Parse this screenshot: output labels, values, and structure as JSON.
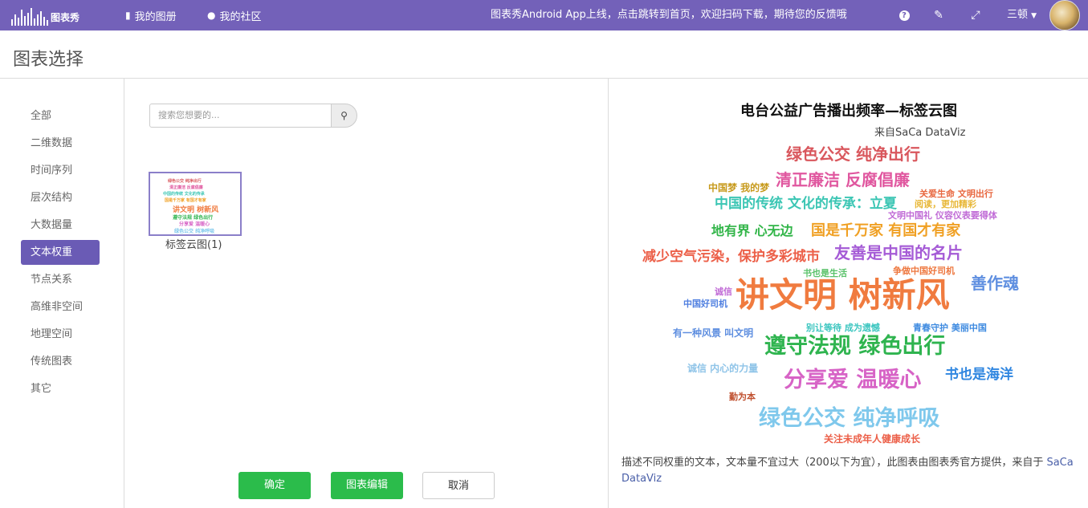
{
  "topbar": {
    "logo_text": "图表秀",
    "nav": [
      {
        "label": "我的图册",
        "icon": "book-icon"
      },
      {
        "label": "我的社区",
        "icon": "globe-icon"
      }
    ],
    "announcement": "图表秀Android App上线，点击跳转到首页，欢迎扫码下载，期待您的反馈哦",
    "help_glyph": "?",
    "user_name": "三顿",
    "background_color": "#7361b9"
  },
  "page": {
    "title": "图表选择"
  },
  "sidebar": {
    "active_index": 5,
    "items": [
      {
        "label": "全部"
      },
      {
        "label": "二维数据"
      },
      {
        "label": "时间序列"
      },
      {
        "label": "层次结构"
      },
      {
        "label": "大数据量"
      },
      {
        "label": "文本权重"
      },
      {
        "label": "节点关系"
      },
      {
        "label": "高维非空间"
      },
      {
        "label": "地理空间"
      },
      {
        "label": "传统图表"
      },
      {
        "label": "其它"
      }
    ]
  },
  "search": {
    "placeholder": "搜索您想要的..."
  },
  "gallery": {
    "items": [
      {
        "label": "标签云图(1)",
        "selected": true
      }
    ]
  },
  "buttons": {
    "confirm": "确定",
    "edit": "图表编辑",
    "cancel": "取消"
  },
  "preview": {
    "title": "电台公益广告播出频率—标签云图",
    "subtitle": "来自SaCa DataViz",
    "description": "描述不同权重的文本，文本量不宜过大（200以下为宜），此图表由图表秀官方提供，来自于",
    "description_source": "SaCa DataViz",
    "words": [
      {
        "text": "绿色公交 纯净出行",
        "color": "#d9575d"
      },
      {
        "text": "清正廉洁 反腐倡廉",
        "color": "#e0579f"
      },
      {
        "text": "中国梦 我的梦",
        "color": "#c79a1c"
      },
      {
        "text": "中国的传统 文化的传承：立夏",
        "color": "#3cc6b4"
      },
      {
        "text": "关爱生命 文明出行",
        "color": "#e8673f"
      },
      {
        "text": "阅读，更加精彩",
        "color": "#e8b83a"
      },
      {
        "text": "文明中国礼 仪容仪表要得体",
        "color": "#c06ad6"
      },
      {
        "text": "地有界 心无边",
        "color": "#31b548"
      },
      {
        "text": "国是千万家 有国才有家",
        "color": "#f0a023"
      },
      {
        "text": "减少空气污染，保护多彩城市",
        "color": "#ec5f48"
      },
      {
        "text": "友善是中国的名片",
        "color": "#a55bd6"
      },
      {
        "text": "书也是生活",
        "color": "#59c26a"
      },
      {
        "text": "争做中国好司机",
        "color": "#ee7840"
      },
      {
        "text": "诚信",
        "color": "#c06ad6"
      },
      {
        "text": "讲文明 树新风",
        "color": "#f07b3f"
      },
      {
        "text": "善作魂",
        "color": "#5f8fe0"
      },
      {
        "text": "中国好司机",
        "color": "#4f7fe0"
      },
      {
        "text": "有一种风景 叫文明",
        "color": "#5f8fe0"
      },
      {
        "text": "别让等待 成为遗憾",
        "color": "#3cc6c0"
      },
      {
        "text": "青春守护 美丽中国",
        "color": "#3f8be0"
      },
      {
        "text": "遵守法规 绿色出行",
        "color": "#2fb44f"
      },
      {
        "text": "诚信 内心的力量",
        "color": "#8fc4e8"
      },
      {
        "text": "分享爱 温暖心",
        "color": "#d763c6"
      },
      {
        "text": "书也是海洋",
        "color": "#2f86e0"
      },
      {
        "text": "勤为本",
        "color": "#c0502f"
      },
      {
        "text": "绿色公交 纯净呼吸",
        "color": "#7fc8ec"
      },
      {
        "text": "关注未成年人健康成长",
        "color": "#ec5f48"
      }
    ]
  }
}
